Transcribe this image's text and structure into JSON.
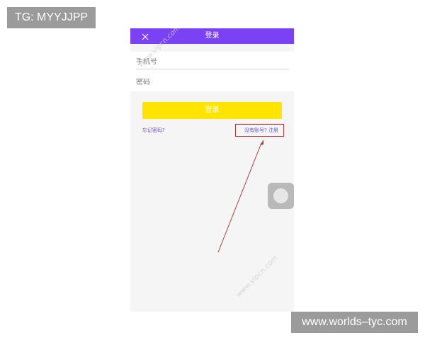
{
  "overlay": {
    "top_tag": "TG: MYYJJPP",
    "bottom_tag": "www.worlds–tyc.com"
  },
  "screen": {
    "header": {
      "title": "登录",
      "close_icon": "close-icon"
    },
    "form": {
      "phone_placeholder": "手机号",
      "password_placeholder": "密码"
    },
    "login_button": "登录",
    "forgot_password": "忘记密码?",
    "register_prompt": "没有账号? 注册",
    "watermark": "www.vipcn.com"
  },
  "colors": {
    "header": "#7b42f5",
    "login_button": "#ffe400",
    "link": "#6b4fbf",
    "annotation": "#c03535"
  }
}
